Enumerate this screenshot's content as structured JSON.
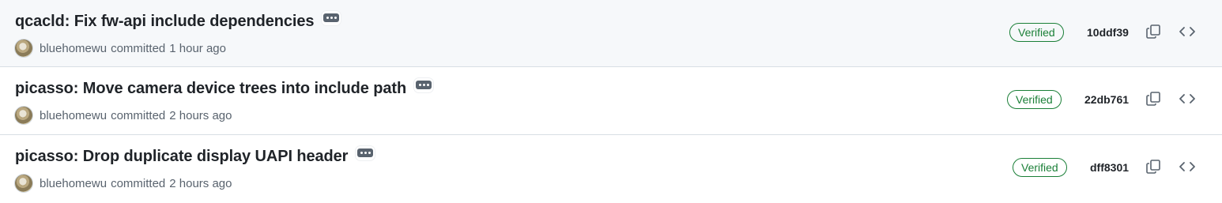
{
  "commits": [
    {
      "title": "qcacld: Fix fw-api include dependencies",
      "author": "bluehomewu",
      "action": "committed",
      "time": "1 hour ago",
      "verified_label": "Verified",
      "sha": "10ddf39",
      "copy_icon": "copy-icon",
      "browse_icon": "code-icon"
    },
    {
      "title": "picasso: Move camera device trees into include path",
      "author": "bluehomewu",
      "action": "committed",
      "time": "2 hours ago",
      "verified_label": "Verified",
      "sha": "22db761",
      "copy_icon": "copy-icon",
      "browse_icon": "code-icon"
    },
    {
      "title": "picasso: Drop duplicate display UAPI header",
      "author": "bluehomewu",
      "action": "committed",
      "time": "2 hours ago",
      "verified_label": "Verified",
      "sha": "dff8301",
      "copy_icon": "copy-icon",
      "browse_icon": "code-icon"
    }
  ],
  "colors": {
    "verified": "#1a7f37",
    "text_primary": "#1f2328",
    "text_muted": "#59636e",
    "row_highlight": "#f6f8fa",
    "border": "#d8dee4"
  }
}
